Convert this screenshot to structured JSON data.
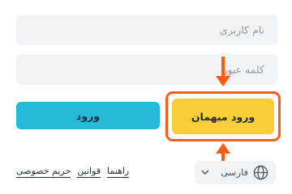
{
  "form": {
    "username_placeholder": "نام کاربری",
    "password_placeholder": "کلمه عبور"
  },
  "buttons": {
    "login_label": "ورود",
    "guest_label": "ورود میهمان"
  },
  "footer": {
    "links": [
      "راهنما",
      "قوانین",
      "حریم خصوصی"
    ],
    "language": "فارسی"
  },
  "colors": {
    "login_button": "#24b8d9",
    "guest_button": "#f8cd3a",
    "highlight": "#ff5c12",
    "field_background": "#f1f4f6"
  },
  "icons": [
    "globe-icon",
    "chevron-down-icon"
  ]
}
